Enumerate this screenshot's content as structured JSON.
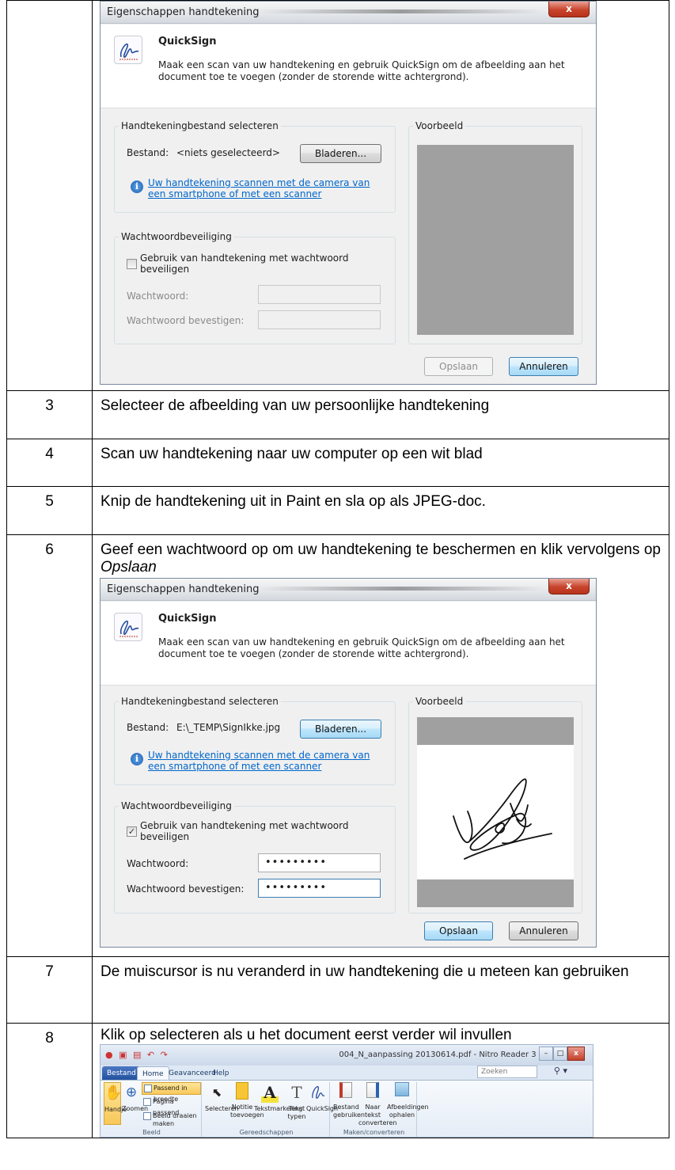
{
  "dialog1": {
    "title": "Eigenschappen handtekening",
    "close": "x",
    "app_name": "QuickSign",
    "description": "Maak een scan van uw handtekening en gebruik QuickSign om de afbeelding aan het document toe te voegen (zonder de storende witte achtergrond).",
    "file_group": "Handtekeningbestand selecteren",
    "file_label": "Bestand:",
    "file_value": "<niets geselecteerd>",
    "browse": "Bladeren...",
    "scan_link_1": "Uw handtekening scannen met de camera van",
    "scan_link_2": "een smartphone of met een scanner",
    "password_group": "Wachtwoordbeveiliging",
    "checkbox_label_1": "Gebruik van handtekening met wachtwoord",
    "checkbox_label_2": "beveiligen",
    "checked": false,
    "password_label": "Wachtwoord:",
    "confirm_label": "Wachtwoord bevestigen:",
    "password_value": "",
    "confirm_value": "",
    "preview_group": "Voorbeeld",
    "save": "Opslaan",
    "cancel": "Annuleren"
  },
  "rows": [
    {
      "num": "3",
      "text": "Selecteer de afbeelding van uw persoonlijke handtekening"
    },
    {
      "num": "4",
      "text": "Scan uw handtekening naar uw computer op een wit blad"
    },
    {
      "num": "5",
      "text": "Knip de handtekening uit in Paint en sla op als JPEG-doc."
    },
    {
      "num": "6",
      "text_before": "Geef een wachtwoord op om uw handtekening te beschermen en klik vervolgens op ",
      "text_em": "Opslaan"
    },
    {
      "num": "7",
      "text": "De muiscursor is nu veranderd in uw handtekening die u meteen kan gebruiken"
    },
    {
      "num": "8",
      "text": "Klik op selecteren als u het document eerst verder wil invullen"
    }
  ],
  "dialog2": {
    "title": "Eigenschappen handtekening",
    "close": "x",
    "app_name": "QuickSign",
    "description": "Maak een scan van uw handtekening en gebruik QuickSign om de afbeelding aan het document toe te voegen (zonder de storende witte achtergrond).",
    "file_group": "Handtekeningbestand selecteren",
    "file_label": "Bestand:",
    "file_value": "E:\\_TEMP\\SignIkke.jpg",
    "browse": "Bladeren...",
    "scan_link_1": "Uw handtekening scannen met de camera van",
    "scan_link_2": "een smartphone of met een scanner",
    "password_group": "Wachtwoordbeveiliging",
    "checkbox_label_1": "Gebruik van handtekening met wachtwoord",
    "checkbox_label_2": "beveiligen",
    "checked": true,
    "check_mark": "✓",
    "password_label": "Wachtwoord:",
    "confirm_label": "Wachtwoord bevestigen:",
    "password_value": "•••••••••",
    "confirm_value": "•••••••••",
    "preview_group": "Voorbeeld",
    "save": "Opslaan",
    "cancel": "Annuleren"
  },
  "ribbon": {
    "title": "004_N_aanpassing 20130614.pdf - Nitro Reader 3",
    "tabs": [
      "Bestand",
      "Home",
      "Geavanceerd",
      "Help"
    ],
    "search_placeholder": "Zoeken",
    "groups": {
      "beeld": {
        "name": "Beeld",
        "handje": "Handje",
        "zoomen": "Zoomen",
        "passend_breedte": "Passend in breedte",
        "pagina_passend": "Pagina passend maken",
        "beeld_draaien": "Beeld draaien"
      },
      "gereedschappen": {
        "name": "Gereedschappen",
        "selecteren": "Selecteren",
        "notitie_1": "Notitie",
        "notitie_2": "toevoegen",
        "tekstmarkering": "Tekstmarkering",
        "tekst_1": "Tekst",
        "tekst_2": "typen",
        "quicksign": "QuickSign"
      },
      "maken": {
        "name": "Maken/converteren",
        "bestand_1": "Bestand",
        "bestand_2": "gebruiken",
        "naartekst_1": "Naar tekst",
        "naartekst_2": "converteren",
        "afbeeldingen_1": "Afbeeldingen",
        "afbeeldingen_2": "ophalen"
      }
    }
  }
}
